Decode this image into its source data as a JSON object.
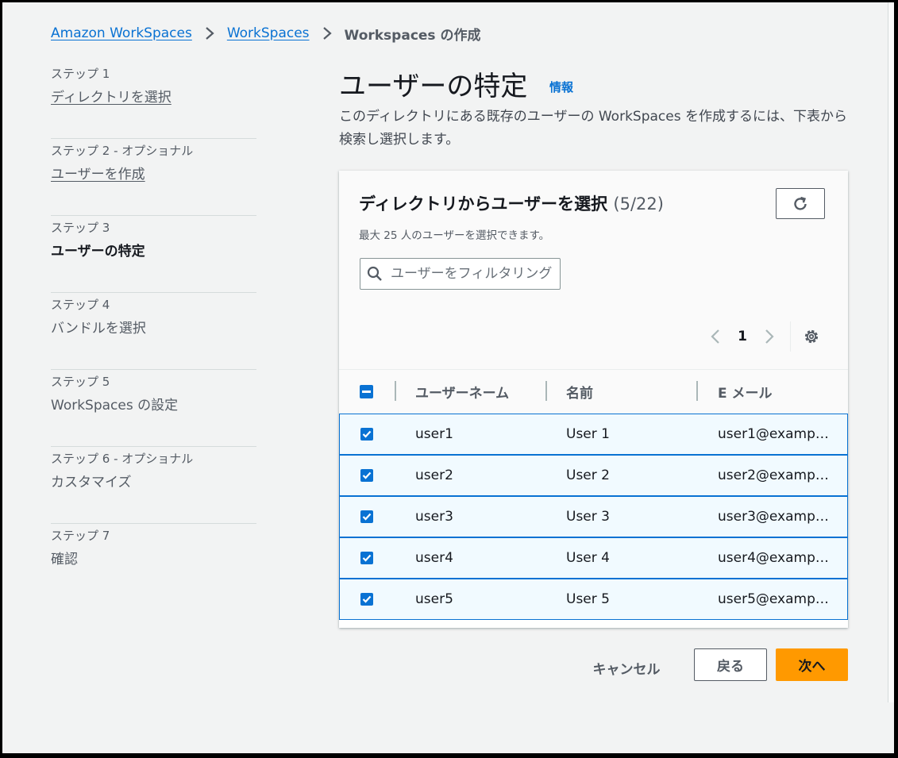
{
  "breadcrumb": {
    "items": [
      "Amazon WorkSpaces",
      "WorkSpaces"
    ],
    "current": "Workspaces の作成"
  },
  "steps": [
    {
      "label": "ステップ 1",
      "name": "ディレクトリを選択",
      "state": "link"
    },
    {
      "label": "ステップ 2 - オプショナル",
      "name": "ユーザーを作成",
      "state": "link"
    },
    {
      "label": "ステップ 3",
      "name": "ユーザーの特定",
      "state": "active"
    },
    {
      "label": "ステップ 4",
      "name": "バンドルを選択",
      "state": "disabled"
    },
    {
      "label": "ステップ 5",
      "name": "WorkSpaces の設定",
      "state": "disabled"
    },
    {
      "label": "ステップ 6 - オプショナル",
      "name": "カスタマイズ",
      "state": "disabled"
    },
    {
      "label": "ステップ 7",
      "name": "確認",
      "state": "disabled"
    }
  ],
  "header": {
    "title": "ユーザーの特定",
    "info": "情報",
    "description": "このディレクトリにある既存のユーザーの WorkSpaces を作成するには、下表から検索し選択します。"
  },
  "table": {
    "title": "ディレクトリからユーザーを選択",
    "count": "(5/22)",
    "description": "最大 25 人のユーザーを選択できます。",
    "filter_placeholder": "ユーザーをフィルタリング",
    "page": "1",
    "columns": [
      "ユーザーネーム",
      "名前",
      "E メール"
    ],
    "rows": [
      {
        "username": "user1",
        "name": "User 1",
        "email": "user1@examp…",
        "selected": true
      },
      {
        "username": "user2",
        "name": "User 2",
        "email": "user2@examp…",
        "selected": true
      },
      {
        "username": "user3",
        "name": "User 3",
        "email": "user3@examp…",
        "selected": true
      },
      {
        "username": "user4",
        "name": "User 4",
        "email": "user4@examp…",
        "selected": true
      },
      {
        "username": "user5",
        "name": "User 5",
        "email": "user5@examp…",
        "selected": true
      }
    ]
  },
  "footer": {
    "cancel": "キャンセル",
    "back": "戻る",
    "next": "次へ"
  },
  "icons": {
    "breadcrumb_separator": "chevron-right-icon",
    "refresh": "refresh-icon",
    "search": "search-icon",
    "prev": "chevron-left-icon",
    "next": "chevron-right-icon",
    "settings": "gear-icon",
    "checkbox": "checkbox-checked-icon",
    "select_all": "checkbox-indeterminate-icon"
  },
  "colors": {
    "link": "#0972d3",
    "primary_button": "#ff9900",
    "background": "#f2f3f3",
    "selected_row": "#f1faff"
  }
}
